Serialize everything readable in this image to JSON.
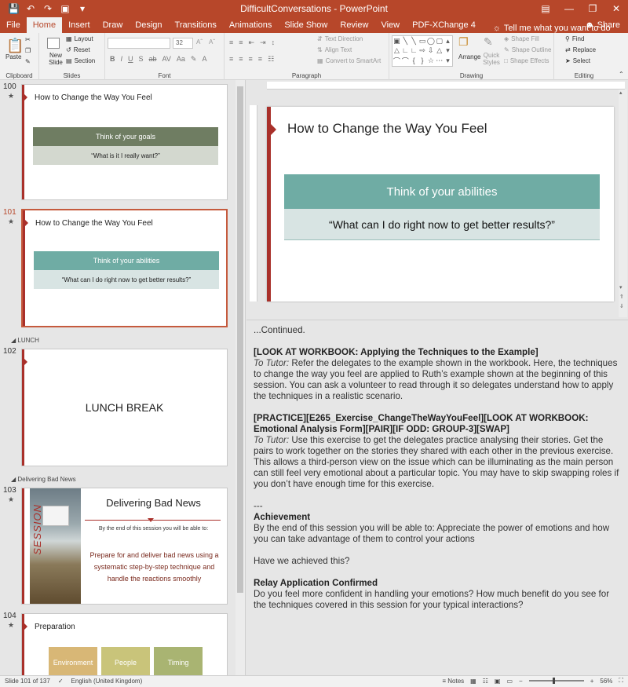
{
  "window": {
    "title": "DifficultConversations - PowerPoint"
  },
  "tabs": [
    "File",
    "Home",
    "Insert",
    "Draw",
    "Design",
    "Transitions",
    "Animations",
    "Slide Show",
    "Review",
    "View",
    "PDF-XChange 4"
  ],
  "active_tab": "Home",
  "tell_me": "Tell me what you want to do",
  "share": "Share",
  "ribbon": {
    "clipboard": {
      "label": "Clipboard",
      "paste": "Paste"
    },
    "slides": {
      "label": "Slides",
      "new_slide": "New Slide",
      "layout": "Layout",
      "reset": "Reset",
      "section": "Section"
    },
    "font": {
      "label": "Font",
      "size": "32"
    },
    "paragraph": {
      "label": "Paragraph",
      "text_direction": "Text Direction",
      "align_text": "Align Text",
      "convert": "Convert to SmartArt"
    },
    "drawing": {
      "label": "Drawing",
      "arrange": "Arrange",
      "quick_styles": "Quick Styles",
      "shape_fill": "Shape Fill",
      "shape_outline": "Shape Outline",
      "shape_effects": "Shape Effects"
    },
    "editing": {
      "label": "Editing",
      "find": "Find",
      "replace": "Replace",
      "select": "Select"
    }
  },
  "thumbnails": [
    {
      "num": "100",
      "title": "How to Change the Way You Feel",
      "band1": "Think of your goals",
      "band2": "“What is it I really want?”"
    },
    {
      "num": "101",
      "title": "How to Change the Way You Feel",
      "band1": "Think of your abilities",
      "band2": "“What can I do right now to get better results?”"
    },
    {
      "num": "102",
      "text": "LUNCH BREAK"
    },
    {
      "num": "103",
      "title": "Delivering Bad News",
      "side_word": "SESSION",
      "subtitle": "By the end of this session you will be able to:",
      "body": "Prepare for and deliver bad news using a systematic step-by-step technique and handle the reactions smoothly"
    },
    {
      "num": "104",
      "title": "Preparation",
      "boxes": [
        "Environment",
        "People",
        "Timing"
      ]
    }
  ],
  "sections": {
    "lunch": "LUNCH",
    "bad_news": "Delivering Bad News"
  },
  "current_slide": {
    "title": "How to Change the Way You Feel",
    "band1": "Think of your abilities",
    "band2": "“What can I do right now to get better results?”"
  },
  "notes": {
    "continued": "...Continued.",
    "h1": "[LOOK AT WORKBOOK: Applying the Techniques to the Example]",
    "tutor_label": "To Tutor:",
    "p1": " Refer the delegates to the example shown in the workbook.  Here, the techniques to change the way you feel are applied to Ruth’s example shown at the beginning of this session. You can ask a volunteer to read through it so delegates understand how to apply the techniques in a realistic scenario.",
    "h2": "[PRACTICE][E265_Exercise_ChangeTheWayYouFeel][LOOK AT WORKBOOK: Emotional Analysis Form][PAIR][IF ODD: GROUP-3][SWAP]",
    "p2": " Use this exercise to get the delegates practice analysing their stories. Get the pairs to work together on the stories they shared with each other in the previous exercise. This allows a third-person view on the issue which can be illuminating as the main person can still feel very emotional about a particular topic. You may have to skip swapping roles if you don’t have enough time for this exercise.",
    "sep": "---",
    "h3": "Achievement",
    "p3": "By the end of this session you will be able to: Appreciate the power of emotions and how you can take advantage of them to control your actions",
    "p4": "Have we achieved this?",
    "h4": "Relay Application Confirmed",
    "p5": "Do you feel more confident in handling your emotions? How much benefit do you see for the techniques covered in this session for your typical interactions?"
  },
  "status": {
    "slide": "Slide 101 of 137",
    "language": "English (United Kingdom)",
    "notes": "Notes",
    "zoom": "56%"
  },
  "colors": {
    "accent": "#b7472a",
    "slide_bar": "#a9302a",
    "band_teal": "#6faca4",
    "band_green": "#6f7d62"
  }
}
